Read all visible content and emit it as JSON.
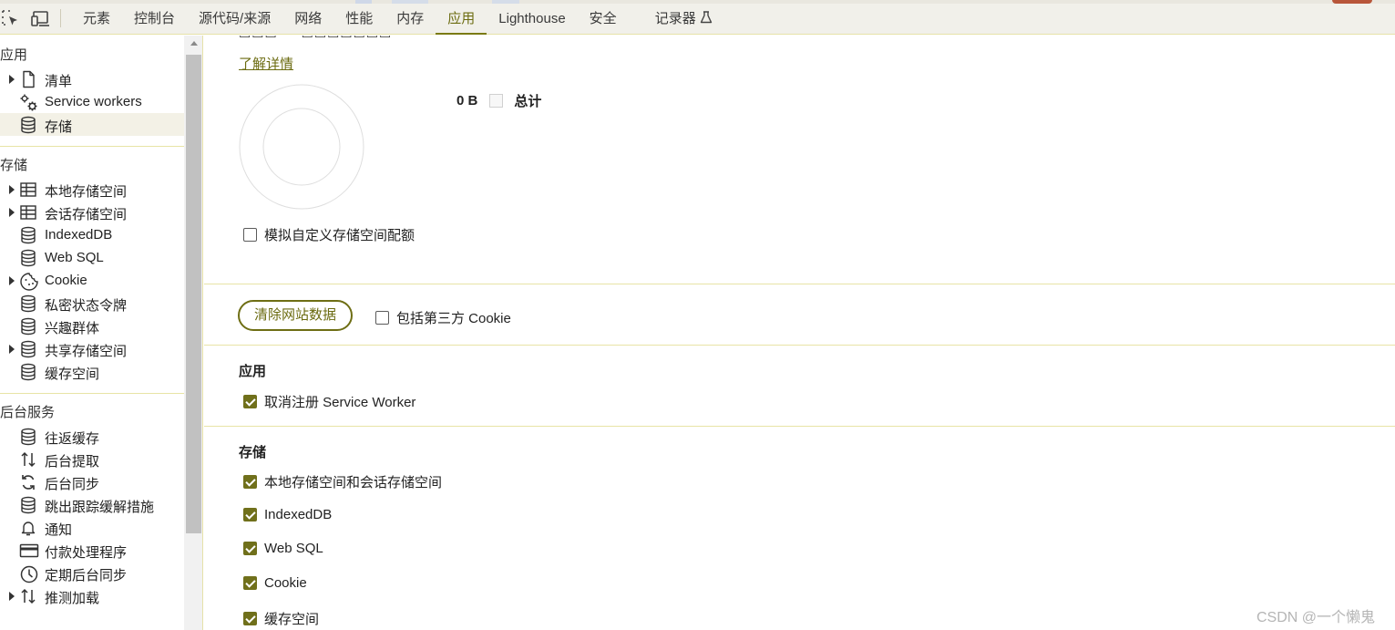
{
  "toolbar": {
    "inspect_icon": "select-element-icon",
    "device_icon": "device-toggle-icon",
    "tabs": [
      {
        "label": "元素"
      },
      {
        "label": "控制台"
      },
      {
        "label": "源代码/来源"
      },
      {
        "label": "网络"
      },
      {
        "label": "性能"
      },
      {
        "label": "内存"
      },
      {
        "label": "应用"
      },
      {
        "label": "Lighthouse"
      },
      {
        "label": "安全"
      },
      {
        "label": "记录器"
      }
    ],
    "active_tab": "应用",
    "recorder_icon": "flask-icon"
  },
  "sidebar": {
    "app_heading": "应用",
    "app_items": [
      {
        "label": "清单",
        "icon": "file-icon",
        "expandable": true
      },
      {
        "label": "Service workers",
        "icon": "gears-icon",
        "expandable": false
      },
      {
        "label": "存储",
        "icon": "database-icon",
        "expandable": false,
        "selected": true
      }
    ],
    "storage_heading": "存储",
    "storage_items": [
      {
        "label": "本地存储空间",
        "icon": "table-icon",
        "expandable": true
      },
      {
        "label": "会话存储空间",
        "icon": "table-icon",
        "expandable": true
      },
      {
        "label": "IndexedDB",
        "icon": "database-icon",
        "expandable": false
      },
      {
        "label": "Web SQL",
        "icon": "database-icon",
        "expandable": false
      },
      {
        "label": "Cookie",
        "icon": "cookie-icon",
        "expandable": true
      },
      {
        "label": "私密状态令牌",
        "icon": "database-icon",
        "expandable": false
      },
      {
        "label": "兴趣群体",
        "icon": "database-icon",
        "expandable": false
      },
      {
        "label": "共享存储空间",
        "icon": "database-icon",
        "expandable": true
      },
      {
        "label": "缓存空间",
        "icon": "database-icon",
        "expandable": false
      }
    ],
    "bg_heading": "后台服务",
    "bg_items": [
      {
        "label": "往返缓存",
        "icon": "database-icon",
        "expandable": false
      },
      {
        "label": "后台提取",
        "icon": "updown-arrows-icon",
        "expandable": false
      },
      {
        "label": "后台同步",
        "icon": "sync-icon",
        "expandable": false
      },
      {
        "label": "跳出跟踪缓解措施",
        "icon": "database-icon",
        "expandable": false
      },
      {
        "label": "通知",
        "icon": "bell-icon",
        "expandable": false
      },
      {
        "label": "付款处理程序",
        "icon": "card-icon",
        "expandable": false
      },
      {
        "label": "定期后台同步",
        "icon": "clock-icon",
        "expandable": false
      },
      {
        "label": "推测加载",
        "icon": "updown-arrows-icon",
        "expandable": true
      }
    ]
  },
  "main": {
    "learn_more": "了解详情",
    "usage_value": "0 B",
    "usage_legend": "总计",
    "quota_checkbox": {
      "label": "模拟自定义存储空间配额",
      "checked": false
    },
    "clear_button": "清除网站数据",
    "third_party_checkbox": {
      "label": "包括第三方 Cookie",
      "checked": false
    },
    "app_section": {
      "title": "应用",
      "items": [
        {
          "label": "取消注册 Service Worker",
          "checked": true
        }
      ]
    },
    "storage_section": {
      "title": "存储",
      "items": [
        {
          "label": "本地存储空间和会话存储空间",
          "checked": true
        },
        {
          "label": "IndexedDB",
          "checked": true
        },
        {
          "label": "Web SQL",
          "checked": true
        },
        {
          "label": "Cookie",
          "checked": true
        },
        {
          "label": "缓存空间",
          "checked": true
        }
      ]
    }
  },
  "watermark": "CSDN @一个懒鬼",
  "colors": {
    "accent": "#70701b",
    "link": "#6b6b10",
    "divider": "#e8e4a6",
    "selected_bg": "#f3f1e6"
  }
}
